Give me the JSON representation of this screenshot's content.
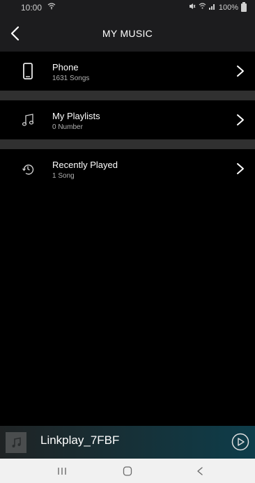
{
  "status_bar": {
    "time": "10:00",
    "right_text": "100%",
    "icons": [
      "wifi-icon",
      "mute-icon",
      "signal-icon",
      "battery-icon"
    ]
  },
  "header": {
    "title": "MY MUSIC",
    "back_icon": "chevron-left-icon"
  },
  "items": [
    {
      "label": "Phone",
      "sub": "1631 Songs",
      "icon": "phone-icon"
    },
    {
      "label": "My Playlists",
      "sub": "0 Number",
      "icon": "music-note-icon"
    },
    {
      "label": "Recently Played",
      "sub": "1 Song",
      "icon": "clock-icon"
    }
  ],
  "player": {
    "device": "Linkplay_7FBF",
    "icons": [
      "album-art-icon",
      "play-icon"
    ]
  },
  "nav": {
    "icons": [
      "recent-apps-icon",
      "home-icon",
      "back-icon"
    ]
  },
  "colors": {
    "background": "#000000",
    "header": "#1c1c1e",
    "separator": "#303030",
    "player_gradient_end": "#0e3d4a",
    "nav_bar": "#f1f1f1"
  }
}
